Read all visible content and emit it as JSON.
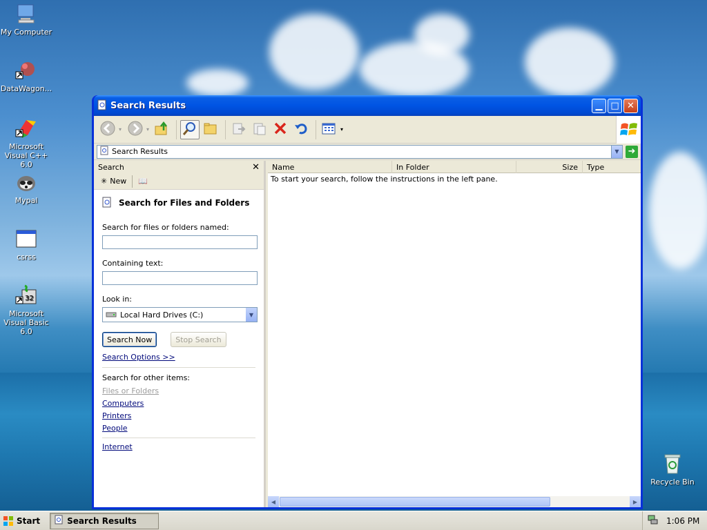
{
  "desktop": {
    "icons": [
      {
        "label": "My Computer"
      },
      {
        "label": "DataWagon..."
      },
      {
        "label": "Microsoft Visual C++ 6.0"
      },
      {
        "label": "Mypal"
      },
      {
        "label": "csrss"
      },
      {
        "label": "Microsoft Visual Basic 6.0"
      },
      {
        "label": "Recycle Bin"
      }
    ]
  },
  "window": {
    "title": "Search Results",
    "address": "Search Results",
    "toolbar_icons": [
      "back-icon",
      "forward-icon",
      "up-folder-icon",
      "search-icon",
      "folders-icon",
      "move-to-icon",
      "copy-to-icon",
      "delete-icon",
      "undo-icon",
      "views-icon"
    ],
    "search_pane": {
      "header": "Search",
      "new_label": "New",
      "heading": "Search for Files and Folders",
      "named_label": "Search for files or folders named:",
      "named_value": "",
      "containing_label": "Containing text:",
      "containing_value": "",
      "look_in_label": "Look in:",
      "look_in_value": "Local Hard Drives (C:)",
      "search_now": "Search Now",
      "stop_search": "Stop Search",
      "search_options": "Search Options  >>",
      "other_items_label": "Search for other items:",
      "other_items": [
        "Files or Folders",
        "Computers",
        "Printers",
        "People"
      ],
      "internet": "Internet"
    },
    "results": {
      "columns": [
        "Name",
        "In Folder",
        "Size",
        "Type"
      ],
      "message": "To start your search, follow the instructions in the left pane."
    }
  },
  "taskbar": {
    "start_label": "Start",
    "task_label": "Search Results",
    "clock": "1:06 PM"
  }
}
